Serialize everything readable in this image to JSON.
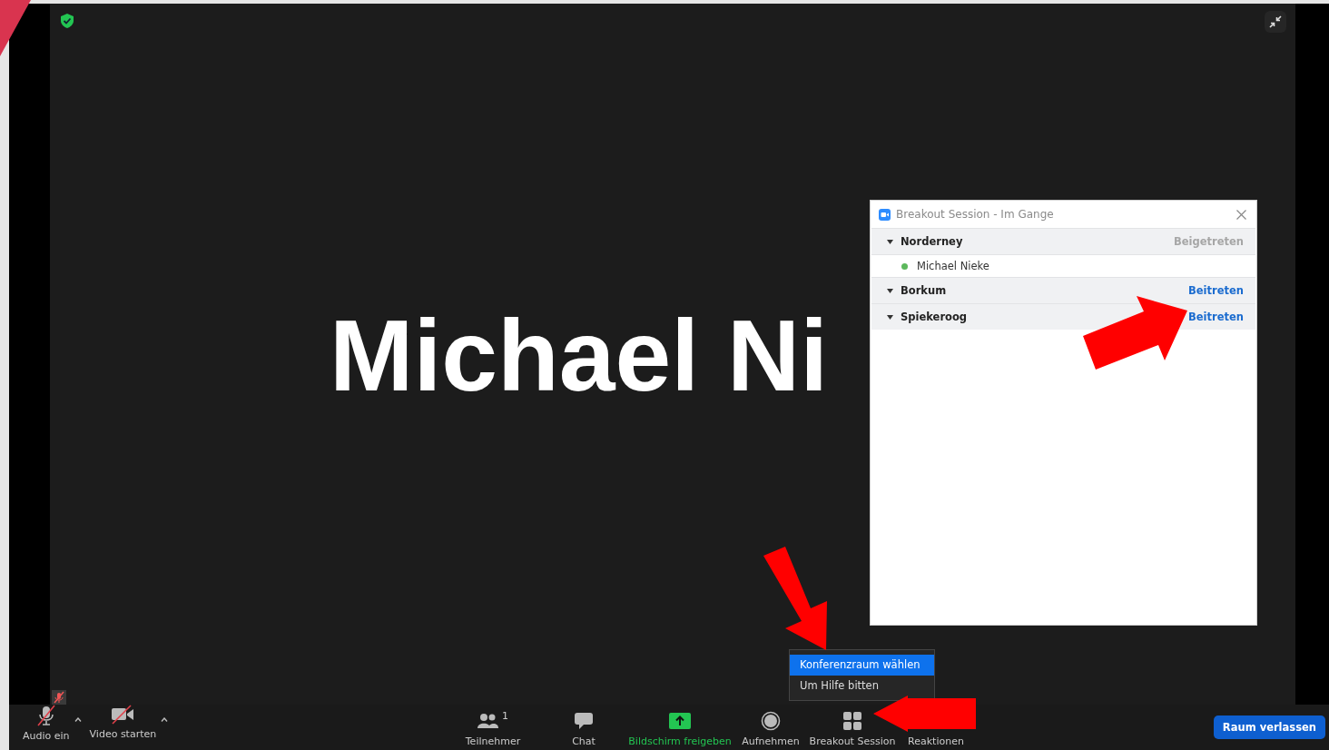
{
  "meeting": {
    "participant_name": "Michael Ni",
    "self_muted": true
  },
  "breakout_window": {
    "title": "Breakout Session - Im Gange",
    "rooms": [
      {
        "name": "Norderney",
        "action": "Beigetreten",
        "joined": true,
        "expanded": true,
        "members": [
          {
            "name": "Michael Nieke"
          }
        ]
      },
      {
        "name": "Borkum",
        "action": "Beitreten",
        "joined": false,
        "expanded": true
      },
      {
        "name": "Spiekeroog",
        "action": "Beitreten",
        "joined": false,
        "expanded": true
      }
    ]
  },
  "dropdown": {
    "items": [
      {
        "label": "Konferenzraum wählen",
        "selected": true
      },
      {
        "label": "Um Hilfe bitten",
        "selected": false
      }
    ]
  },
  "toolbar": {
    "left": [
      {
        "kind": "audio",
        "label": "Audio ein",
        "muted": true
      },
      {
        "kind": "video",
        "label": "Video starten",
        "muted": true
      }
    ],
    "center": [
      {
        "kind": "participants",
        "label": "Teilnehmer",
        "count": "1"
      },
      {
        "kind": "chat",
        "label": "Chat"
      },
      {
        "kind": "share",
        "label": "Bildschirm freigeben"
      },
      {
        "kind": "record",
        "label": "Aufnehmen"
      },
      {
        "kind": "breakout",
        "label": "Breakout Session"
      },
      {
        "kind": "reactions",
        "label": "Reaktionen"
      }
    ],
    "leave_button": "Raum verlassen"
  }
}
